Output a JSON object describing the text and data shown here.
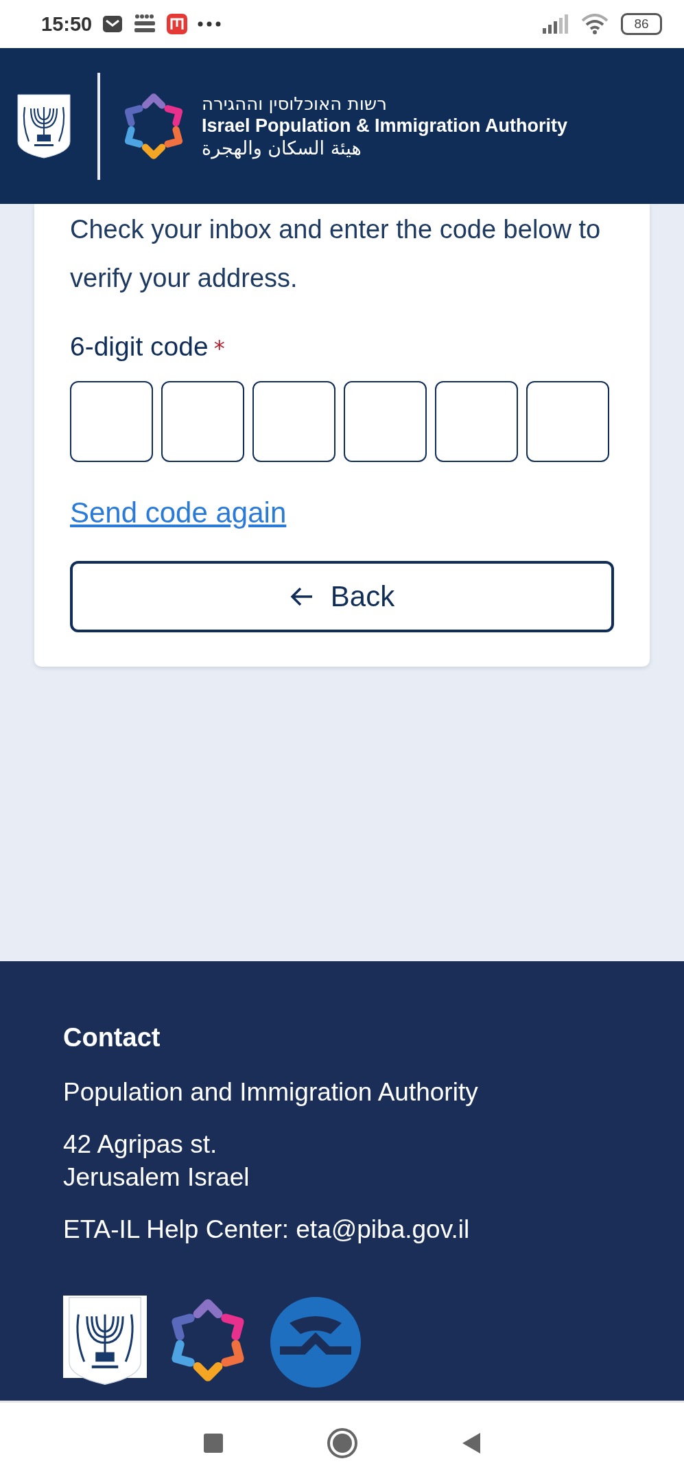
{
  "status_bar": {
    "time": "15:50",
    "battery": "86"
  },
  "header": {
    "title_hebrew": "רשות האוכלוסין וההגירה",
    "title_english": "Israel Population & Immigration Authority",
    "title_arabic": "هيئة السكان والهجرة"
  },
  "verification": {
    "instructions": "Check your inbox and enter the code below to verify your address.",
    "code_label": "6-digit code",
    "required_mark": "*",
    "code_fields": [
      {
        "focused": false
      },
      {
        "focused": false
      },
      {
        "focused": false
      },
      {
        "focused": false
      },
      {
        "focused": false
      },
      {
        "focused": false
      }
    ],
    "resend_link": "Send code again",
    "back_button": "Back"
  },
  "footer": {
    "heading": "Contact",
    "lines": [
      "Population and Immigration Authority",
      "42 Agripas st.\nJerusalem Israel",
      "ETA-IL Help Center: eta@piba.gov.il"
    ]
  }
}
